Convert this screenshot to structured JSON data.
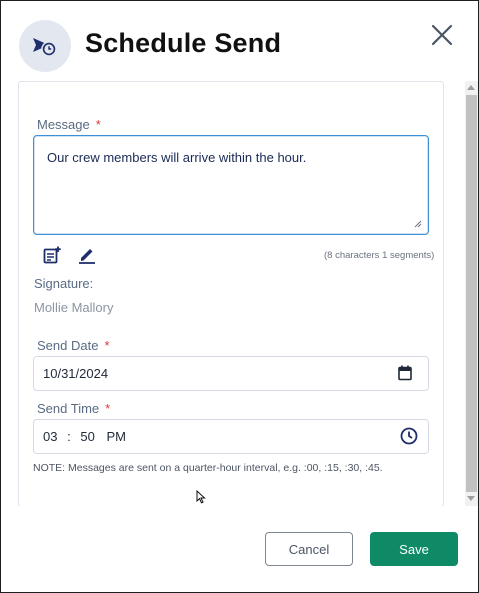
{
  "dialog": {
    "title": "Schedule Send",
    "header_icon": "scheduled-send-icon",
    "close_icon": "close-icon"
  },
  "message": {
    "label": "Message",
    "required_mark": "*",
    "value": "Our crew members will arrive within the hour.",
    "char_count": "(8 characters 1 segments)",
    "template_icon": "insert-template-icon",
    "edit_icon": "edit-pen-icon"
  },
  "signature": {
    "label": "Signature:",
    "value": "Mollie Mallory"
  },
  "send_date": {
    "label": "Send Date",
    "required_mark": "*",
    "value": "10/31/2024",
    "icon": "calendar-icon"
  },
  "send_time": {
    "label": "Send Time",
    "required_mark": "*",
    "hour": "03",
    "separator": ":",
    "minute": "50",
    "period": "PM",
    "icon": "clock-icon"
  },
  "note": "NOTE: Messages are sent on a quarter-hour interval, e.g. :00, :15, :30, :45.",
  "buttons": {
    "cancel": "Cancel",
    "save": "Save"
  },
  "colors": {
    "primary": "#0f8a67",
    "focus_border": "#3d8fd6",
    "required": "#d63b3b",
    "header_icon_bg": "#e3e7f0",
    "icon_navy": "#1f2f6b"
  }
}
